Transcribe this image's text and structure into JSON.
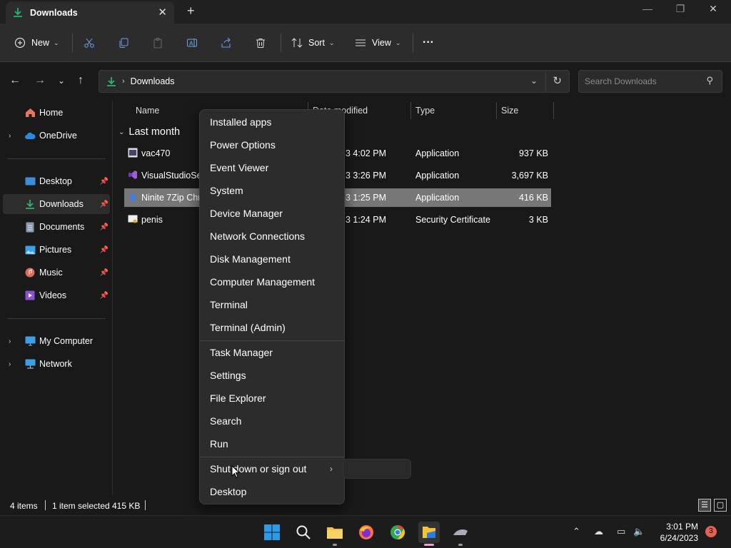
{
  "window": {
    "tab_title": "Downloads",
    "close_tab": "✕",
    "new_tab": "+",
    "minimize": "—",
    "maximize": "❐",
    "close": "✕"
  },
  "toolbar": {
    "new_label": "New",
    "sort_label": "Sort",
    "view_label": "View",
    "more_label": "···"
  },
  "address": {
    "crumb": "Downloads",
    "search_placeholder": "Search Downloads"
  },
  "sidebar": {
    "items": [
      {
        "label": "Home"
      },
      {
        "label": "OneDrive"
      },
      {
        "label": "Desktop"
      },
      {
        "label": "Downloads"
      },
      {
        "label": "Documents"
      },
      {
        "label": "Pictures"
      },
      {
        "label": "Music"
      },
      {
        "label": "Videos"
      },
      {
        "label": "My Computer"
      },
      {
        "label": "Network"
      }
    ]
  },
  "filelist": {
    "columns": {
      "name": "Name",
      "date": "Date modified",
      "type": "Type",
      "size": "Size"
    },
    "group": "Last month",
    "rows": [
      {
        "name": "vac470",
        "date": "3 4:02 PM",
        "type": "Application",
        "size": "937 KB"
      },
      {
        "name": "VisualStudioSet",
        "date": "3 3:26 PM",
        "type": "Application",
        "size": "3,697 KB"
      },
      {
        "name": "Ninite 7Zip Chr",
        "date": "3 1:25 PM",
        "type": "Application",
        "size": "416 KB"
      },
      {
        "name": "penis",
        "date": "3 1:24 PM",
        "type": "Security Certificate",
        "size": "3 KB"
      }
    ]
  },
  "status": {
    "items": "4 items",
    "selected": "1 item selected",
    "selected_size": "415 KB"
  },
  "context_menu": {
    "items": [
      "Installed apps",
      "Power Options",
      "Event Viewer",
      "System",
      "Device Manager",
      "Network Connections",
      "Disk Management",
      "Computer Management",
      "Terminal",
      "Terminal (Admin)",
      "Task Manager",
      "Settings",
      "File Explorer",
      "Search",
      "Run",
      "Shut down or sign out",
      "Desktop"
    ]
  },
  "taskbar": {
    "time": "3:01 PM",
    "date": "6/24/2023",
    "badge": "3"
  },
  "colors": {
    "accent_green": "#2fb36f",
    "selection": "#777777",
    "menu_bg": "#2c2c2c"
  }
}
